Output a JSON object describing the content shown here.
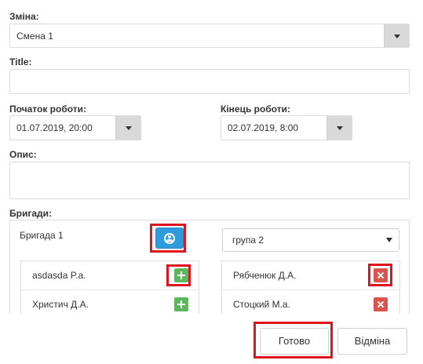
{
  "shift": {
    "label": "Зміна:",
    "value": "Смена 1"
  },
  "title": {
    "label": "Title:",
    "value": ""
  },
  "start": {
    "label": "Початок роботи:",
    "value": "01.07.2019, 20:00"
  },
  "end": {
    "label": "Кінець роботи:",
    "value": "02.07.2019, 8:00"
  },
  "description": {
    "label": "Опис:",
    "value": ""
  },
  "brigades": {
    "label": "Бригади:",
    "brigade_name": "Бригада 1",
    "group_select": "група 2",
    "available": [
      {
        "name": "asdasda P.a."
      },
      {
        "name": "Христич Д.А."
      }
    ],
    "assigned": [
      {
        "name": "Рябченюк Д.А."
      },
      {
        "name": "Стоцкий М.а."
      }
    ]
  },
  "footer": {
    "done_label": "Готово",
    "cancel_label": "Відміна"
  },
  "colors": {
    "highlight": "#e0141e",
    "add": "#5cb85c",
    "remove": "#d9534f",
    "user": "#2d9bdc"
  },
  "icons": {
    "user_button": "user-circle-icon",
    "add": "plus-icon",
    "remove": "times-icon",
    "dropdown": "caret-down-icon"
  }
}
